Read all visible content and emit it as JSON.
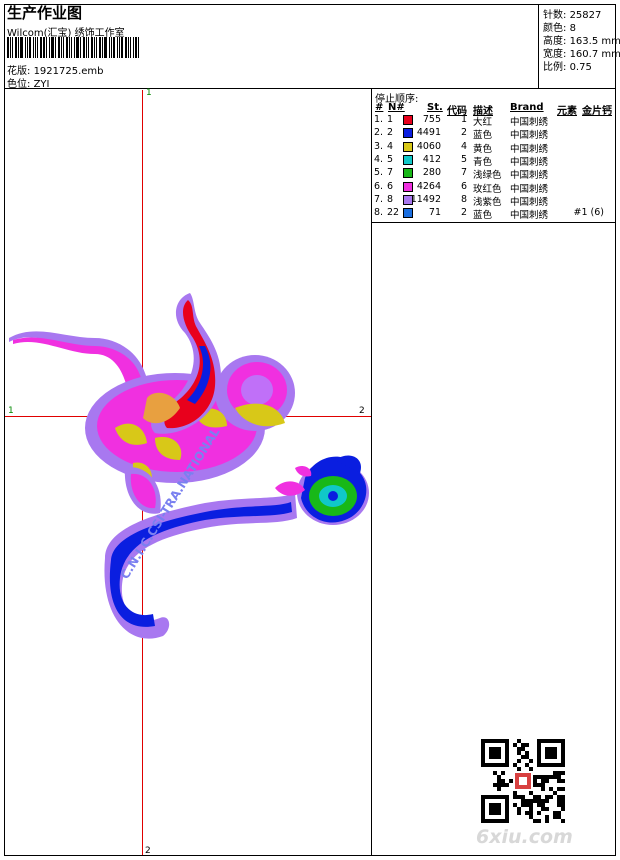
{
  "header": {
    "title": "生产作业图",
    "company": "Wilcom(汇宝) 绣饰工作室",
    "file_label": "花版:",
    "file_value": "1921725.emb",
    "colorpos_label": "色位:",
    "colorpos_value": "ZYI"
  },
  "specs": [
    {
      "label": "针数:",
      "value": "25827"
    },
    {
      "label": "颜色:",
      "value": "8"
    },
    {
      "label": "高度:",
      "value": "163.5 mm"
    },
    {
      "label": "宽度:",
      "value": "160.7 mm"
    },
    {
      "label": "比例:",
      "value": "0.75"
    }
  ],
  "stop_sequence": {
    "title": "停止顺序:",
    "columns": [
      "#",
      "N#",
      "St.",
      "代码",
      "描述",
      "Brand",
      "元素",
      "金片钙"
    ],
    "rows": [
      {
        "num": "1.",
        "n": "1",
        "color": "#e8001c",
        "st": "755",
        "code": "1",
        "desc": "大红",
        "brand": "中国刺绣",
        "element": ""
      },
      {
        "num": "2.",
        "n": "2",
        "color": "#0a1ee0",
        "st": "4491",
        "code": "2",
        "desc": "蓝色",
        "brand": "中国刺绣",
        "element": ""
      },
      {
        "num": "3.",
        "n": "4",
        "color": "#d8c818",
        "st": "4060",
        "code": "4",
        "desc": "黄色",
        "brand": "中国刺绣",
        "element": ""
      },
      {
        "num": "4.",
        "n": "5",
        "color": "#10c8c8",
        "st": "412",
        "code": "5",
        "desc": "青色",
        "brand": "中国刺绣",
        "element": ""
      },
      {
        "num": "5.",
        "n": "7",
        "color": "#18b818",
        "st": "280",
        "code": "7",
        "desc": "浅绿色",
        "brand": "中国刺绣",
        "element": ""
      },
      {
        "num": "6.",
        "n": "6",
        "color": "#f030e0",
        "st": "4264",
        "code": "6",
        "desc": "玫红色",
        "brand": "中国刺绣",
        "element": ""
      },
      {
        "num": "7.",
        "n": "8",
        "color": "#a878f0",
        "st": "11492",
        "code": "8",
        "desc": "浅紫色",
        "brand": "中国刺绣",
        "element": ""
      },
      {
        "num": "8.",
        "n": "22",
        "color": "#1a6ee0",
        "st": "71",
        "code": "2",
        "desc": "蓝色",
        "brand": "中国刺绣",
        "element": "#1 (6)"
      }
    ]
  },
  "guides": {
    "left": "1",
    "right": "2",
    "top": "1",
    "bottom": "2"
  },
  "design_text": "C.N.I.C.CSI-TRA.NATIONAL",
  "watermark": "6xiu.com",
  "colors": {
    "guide": "#e00000",
    "label_green": "#008800"
  }
}
